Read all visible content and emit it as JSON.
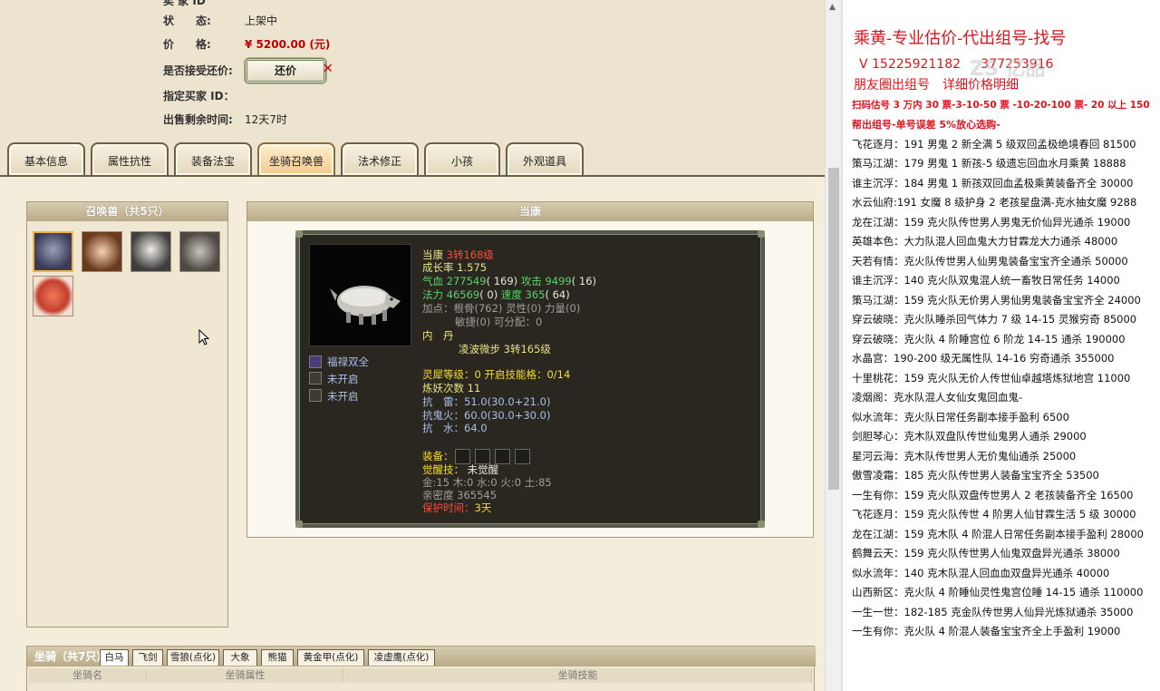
{
  "top_info": {
    "cut_id_label": "卖 家 ID",
    "status_label": "状　　态:",
    "status_value": "上架中",
    "price_label": "价　　格:",
    "price_value": "¥ 5200.00 (元)",
    "offer_label": "是否接受还价:",
    "offer_button": "还价",
    "buyer_label": "指定买家 ID：",
    "remaining_label": "出售剩余时间:",
    "remaining_value": "12天7时"
  },
  "tabs": [
    "基本信息",
    "属性抗性",
    "装备法宝",
    "坐骑召唤兽",
    "法术修正",
    "小孩",
    "外观道具"
  ],
  "active_tab": "坐骑召唤兽",
  "summon_panel": {
    "title": "召唤兽（共5只）"
  },
  "detail": {
    "panel_title": "当康",
    "name": "当康",
    "level": "3转168级",
    "growth": "成长率 1.575",
    "hp_label": "气血",
    "hp": "277549",
    "hp_pts": "( 169)",
    "atk_label": "攻击",
    "atk": "9499",
    "atk_pts": "( 16)",
    "mp_label": "法力",
    "mp": "46569",
    "mp_pts": "( 0)",
    "spd_label": "速度",
    "spd": "365",
    "spd_pts": "( 64)",
    "bonus_line1": "加点：根骨(762) 灵性(0) 力量(0)",
    "bonus_line2": "敏捷(0) 可分配：0",
    "neidan": "内　丹",
    "neidan_item": "凌波微步 3转165级",
    "skills": [
      "福禄双全",
      "未开启",
      "未开启"
    ],
    "lingxi": "灵犀等级：0 开启技能格：0/14",
    "lianyao": "炼妖次数 11",
    "kang_lei": "抗　雷：51.0(30.0+21.0)",
    "kang_guihuo": "抗鬼火：60.0(30.0+30.0)",
    "kang_shui": "抗　水：64.0",
    "equip_label": "装备：",
    "awaken_label": "觉醒技：",
    "awaken_value": "未觉醒",
    "elements": "金:15 木:0 水:0 火:0 土:85",
    "intimacy": "亲密度 365545",
    "protect_label": "保护时间：",
    "protect_value": "3天"
  },
  "mount": {
    "title": "坐骑（共7只）",
    "tabs": [
      "白马",
      "飞剑",
      "雪狼(点化)",
      "大象",
      "熊猫",
      "黄金甲(点化)",
      "凌虚鹰(点化)"
    ],
    "columns": [
      "坐骑名",
      "坐骑属性",
      "坐骑技能"
    ]
  },
  "right": {
    "title": "乘黄-专业估价-代出组号-找号",
    "phone": "V 15225921182",
    "phone2": "377253916",
    "watermark": "ZS 亿品",
    "subtitle": "朋友圈出组号　详细价格明细",
    "line1": "扫码估号 3 万内 30 票-3-10-50 票 -10-20-100 票- 20 以上 150",
    "line2": "帮出组号-单号误差 5%放心选购-",
    "items": [
      "飞花逐月：191 男鬼 2 新全满 5 级双回孟极绝境春回 81500",
      "策马江湖：179 男鬼 1 新孩-5 级遗忘回血水月乘黄 18888",
      "谁主沉浮：184 男鬼 1 新孩双回血孟极乘黄装备齐全 30000",
      "水云仙府:191 女魔 8 级护身 2 老孩星盘满-克水抽女魔 9288",
      "龙在江湖：159 克火队传世男人男鬼无价仙异光通杀 19000",
      "英雄本色：大力队混人回血鬼大力甘霖龙大力通杀 48000",
      "天若有情：克火队传世男人仙男鬼装备宝宝齐全通杀 50000",
      "谁主沉浮：140 克火队双鬼混人统一畜牧日常任务 14000",
      "策马江湖：159 克火队无价男人男仙男鬼装备宝宝齐全 24000",
      "穿云破晓：克火队睡杀回气体力 7 级 14-15 灵猴穷奇 85000",
      "穿云破晓：克火队 4 阶睡宫位 6 阶龙 14-15 通杀 190000",
      "水晶宫：190-200 级无属性队 14-16 穷奇通杀 355000",
      "十里桃花：159 克火队无价人传世仙卓越塔炼狱地宫 11000",
      "凌烟阁：克水队混人女仙女鬼回血鬼-",
      "似水流年：克火队日常任务副本接手盈利 6500",
      "剑胆琴心：克木队双盘队传世仙鬼男人通杀 29000",
      "星河云海：克木队传世男人无价鬼仙通杀 25000",
      "傲雪凌霜：185 克火队传世男人装备宝宝齐全 53500",
      "一生有你：159 克火队双盘传世男人 2 老孩装备齐全 16500",
      "飞花逐月：159 克火队传世 4 阶男人仙甘霖生活 5 级 30000",
      "龙在江湖：159 克木队 4 阶混人日常任务副本接手盈利 28000",
      "鹤舞云天：159 克火队传世男人仙鬼双盘异光通杀 38000",
      "似水流年：140 克木队混人回血血双盘异光通杀 40000",
      "山西新区：克火队 4 阶睡仙灵性鬼宫位睡 14-15 通杀 110000",
      "一生一世：182-185 克金队传世男人仙异光炼狱通杀 35000",
      "一生有你：克火队 4 阶混人装备宝宝齐全上手盈利 19000"
    ]
  }
}
